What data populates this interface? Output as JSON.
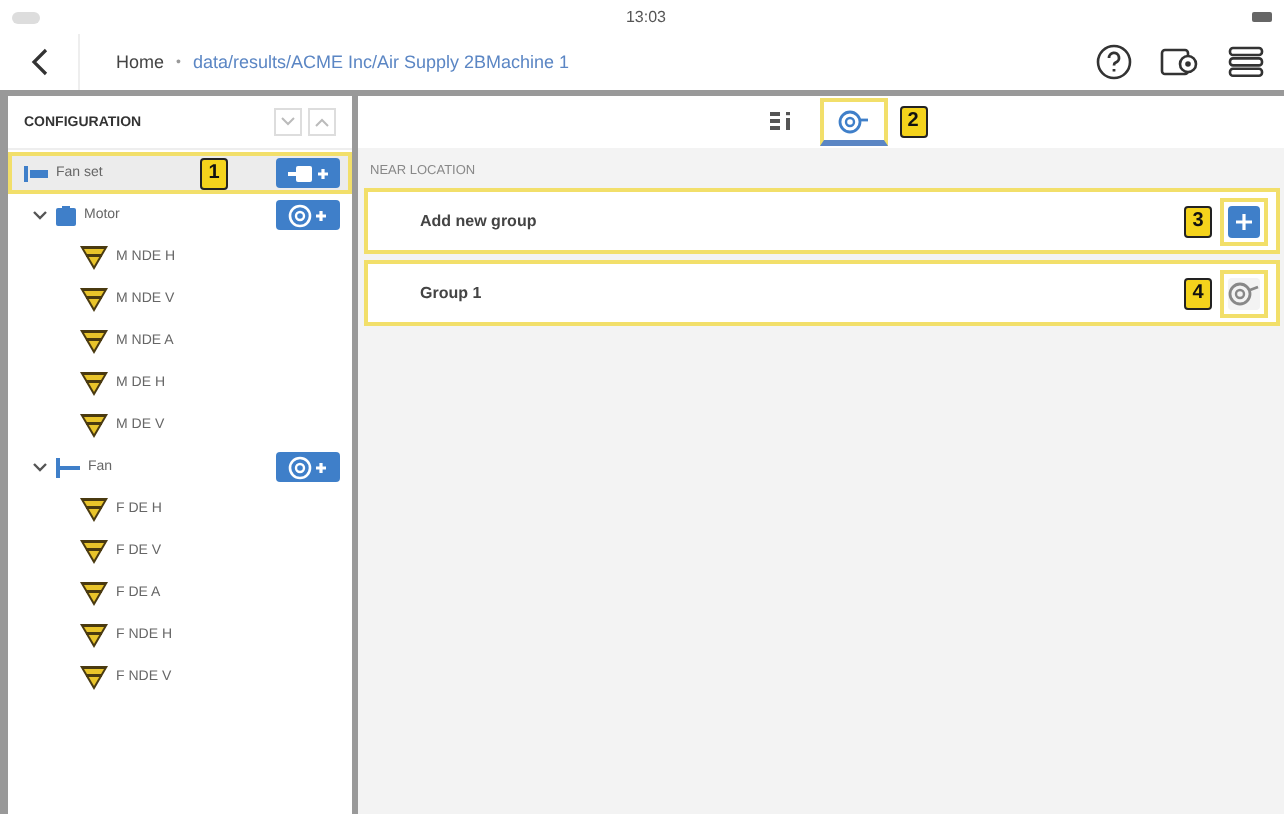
{
  "status_bar": {
    "time": "13:03"
  },
  "nav": {
    "home": "Home",
    "separator": "•",
    "path": "data/results/ACME Inc/Air Supply 2BMachine 1"
  },
  "sidebar": {
    "title": "CONFIGURATION",
    "tree": [
      {
        "label": "Fan set",
        "kind": "machine",
        "selected": true,
        "callout": "1",
        "button": {
          "kind": "add-component"
        },
        "children": [
          {
            "label": "Motor",
            "kind": "motor",
            "expanded": true,
            "selected": false,
            "button": {
              "kind": "add-point"
            },
            "children": [
              {
                "label": "M NDE H",
                "kind": "point",
                "selected": false
              },
              {
                "label": "M NDE V",
                "kind": "point",
                "selected": false
              },
              {
                "label": "M NDE A",
                "kind": "point",
                "selected": false
              },
              {
                "label": "M DE H",
                "kind": "point",
                "selected": false
              },
              {
                "label": "M DE V",
                "kind": "point",
                "selected": false
              }
            ]
          },
          {
            "label": "Fan",
            "kind": "fan",
            "expanded": true,
            "selected": false,
            "button": {
              "kind": "add-point"
            },
            "children": [
              {
                "label": "F DE H",
                "kind": "point",
                "selected": false
              },
              {
                "label": "F DE V",
                "kind": "point",
                "selected": false
              },
              {
                "label": "F DE A",
                "kind": "point",
                "selected": false
              },
              {
                "label": "F NDE H",
                "kind": "point",
                "selected": false
              },
              {
                "label": "F NDE V",
                "kind": "point",
                "selected": false
              }
            ]
          }
        ]
      }
    ]
  },
  "tabs": [
    {
      "kind": "info",
      "selected": false
    },
    {
      "kind": "sensor",
      "selected": true,
      "callout": "2"
    }
  ],
  "section": {
    "title": "NEAR LOCATION"
  },
  "groups": [
    {
      "label": "Add new group",
      "kind": "add",
      "callout": "3"
    },
    {
      "label": "Group 1",
      "kind": "group",
      "callout": "4"
    }
  ]
}
